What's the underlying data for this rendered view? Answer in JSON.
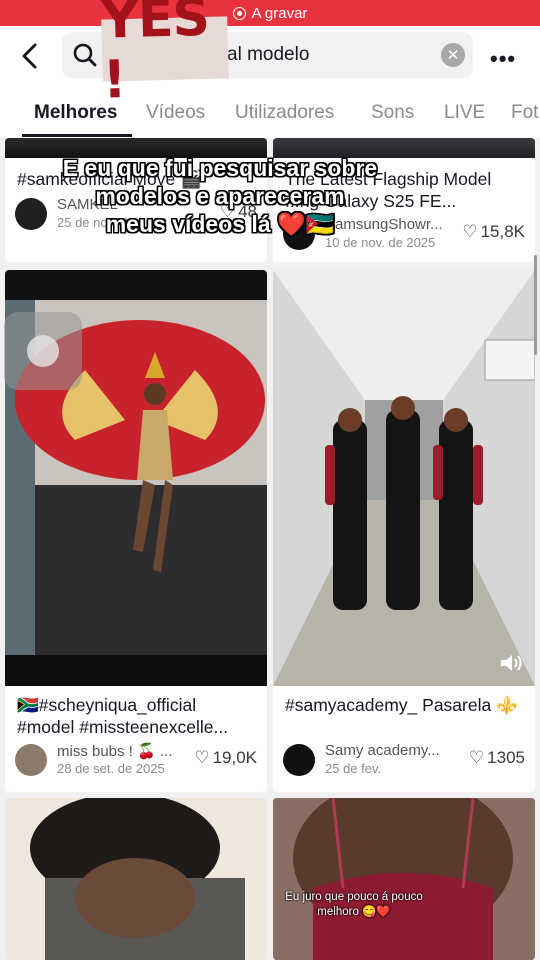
{
  "status": {
    "recording": "A gravar"
  },
  "search": {
    "query": "al modelo"
  },
  "tabs": [
    "Melhores",
    "Vídeos",
    "Utilizadores",
    "Sons",
    "LIVE",
    "Fot"
  ],
  "overlay": {
    "line1": "E eu que fui pesquisar sobre",
    "line2": "modelos e apareceram",
    "line3": "meus vídeos lá ❤️🇲🇿",
    "sticker": "YES !"
  },
  "cards": [
    {
      "caption": "#samkeofficial Move 🎬",
      "user": "SAMKEL",
      "date": "25 de nov. de 2023",
      "likes": "48"
    },
    {
      "caption": "The Latest Flagship Model ...ng Galaxy S25 FE...",
      "user": "SamsungShowr...",
      "date": "10 de nov. de 2025",
      "likes": "15,8K"
    },
    {
      "caption": "🇿🇦#scheyniqua_official #model #missteenexcelle...",
      "user": "miss bubs ! 🍒 ...",
      "date": "28 de set. de 2025",
      "likes": "19,0K"
    },
    {
      "caption": "#samyacademy_ Pasarela ⚜️",
      "user": "Samy academy...",
      "date": "25 de fev.",
      "likes": "1305"
    },
    {
      "caption": ""
    },
    {
      "caption": "",
      "overlay": "Eu juro que pouco á pouco melhoro 😋❤️"
    }
  ],
  "colors": {
    "rec_bar": "#e8333e",
    "accent_text": "#161823",
    "muted": "#8a8b91"
  }
}
